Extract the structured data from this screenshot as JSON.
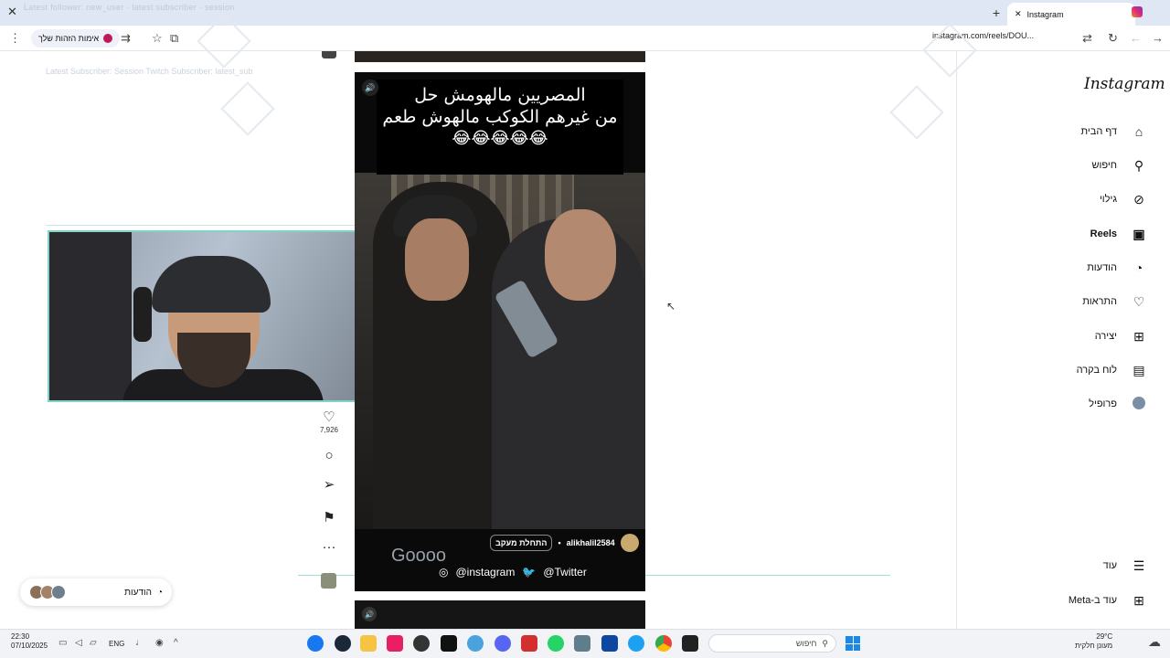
{
  "browser": {
    "tab_title": "Instagram",
    "overlay_top_text": "Latest follower: new_user · latest subscriber · session",
    "address": "instagram.com/reels/DOU...",
    "privacy_label": "אימות הזהות שלך"
  },
  "overlay": {
    "subscriber_text": "Latest Subscriber: Session Twitch Subscriber: latest_sub"
  },
  "reel": {
    "caption_line1": "المصريين مالهومش حل",
    "caption_line2": "من غيرهم الكوكب مالهوش طعم",
    "caption_line3": "😂😂😂😂😂",
    "owner": "alikhalil2584",
    "follow_label": "התחלת מעקב",
    "overlay_gooo": "Goooo",
    "social_instagram": "@instagram",
    "social_twitter": "@Twitter"
  },
  "actions": {
    "like_count": "7,926"
  },
  "messages": {
    "label": "הודעות"
  },
  "sidebar": {
    "logo": "Instagram",
    "items": [
      {
        "label": "דף הבית",
        "icon": "home-icon"
      },
      {
        "label": "חיפוש",
        "icon": "search-icon"
      },
      {
        "label": "גילוי",
        "icon": "compass-icon"
      },
      {
        "label": "Reels",
        "icon": "reels-icon"
      },
      {
        "label": "הודעות",
        "icon": "messenger-icon"
      },
      {
        "label": "התראות",
        "icon": "heart-icon"
      },
      {
        "label": "יצירה",
        "icon": "plus-square-icon"
      },
      {
        "label": "לוח בקרה",
        "icon": "dashboard-icon"
      },
      {
        "label": "פרופיל",
        "icon": "avatar"
      }
    ],
    "more": "עוד",
    "meta": "עוד ב-Meta"
  },
  "taskbar": {
    "time": "22:30",
    "date": "07/10/2025",
    "lang": "ENG",
    "search_placeholder": "חיפוש",
    "temp": "29°C",
    "weather": "מעונן חלקית"
  },
  "colors": {
    "accent": "#0095f6",
    "overlay_teal": "#7fd3c8"
  }
}
